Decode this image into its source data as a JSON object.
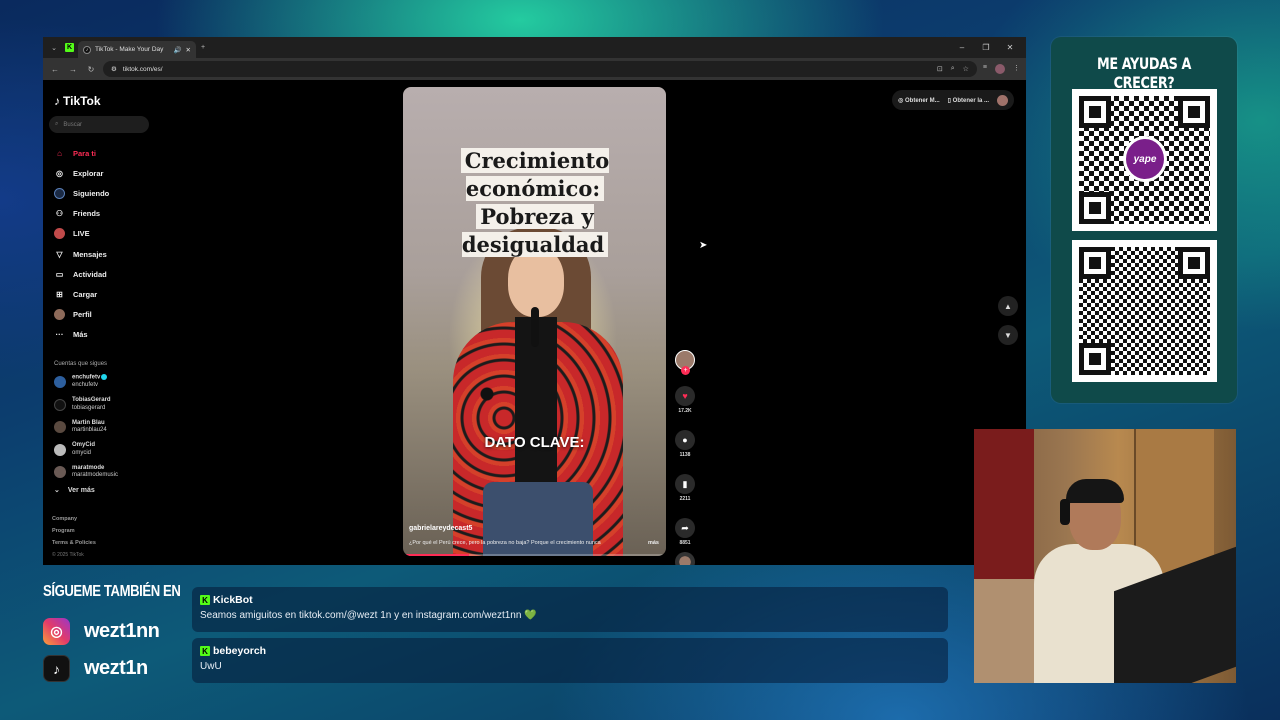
{
  "colors": {
    "accent_tiktok": "#fe2c55",
    "kick_green": "#53fc18",
    "panel_teal": "#0f4a4a"
  },
  "browser": {
    "tab_title": "TikTok - Make Your Day",
    "url": "tiktok.com/es/",
    "window_controls": [
      "–",
      "❐",
      "✕"
    ]
  },
  "tiktok": {
    "logo": "TikTok",
    "search_placeholder": "Buscar",
    "menu": [
      {
        "label": "Para ti",
        "icon": "home-icon"
      },
      {
        "label": "Explorar",
        "icon": "compass-icon"
      },
      {
        "label": "Siguiendo",
        "icon": "following-icon"
      },
      {
        "label": "Friends",
        "icon": "friends-icon"
      },
      {
        "label": "LIVE",
        "icon": "live-icon"
      },
      {
        "label": "Mensajes",
        "icon": "messages-icon"
      },
      {
        "label": "Actividad",
        "icon": "activity-icon"
      },
      {
        "label": "Cargar",
        "icon": "upload-icon"
      },
      {
        "label": "Perfil",
        "icon": "profile-icon"
      },
      {
        "label": "Más",
        "icon": "more-icon"
      }
    ],
    "following_title": "Cuentas que sigues",
    "following": [
      {
        "name": "enchufetv",
        "handle": "enchufetv"
      },
      {
        "name": "TobiasGerard",
        "handle": "tobiasgerard"
      },
      {
        "name": "Martin Blau",
        "handle": "martinblau24"
      },
      {
        "name": "OmyCid",
        "handle": "omycid"
      },
      {
        "name": "maratmode",
        "handle": "maratmodemusic"
      }
    ],
    "see_more": "Ver más",
    "footer": [
      "Company",
      "Program",
      "Terms & Policies"
    ],
    "copyright": "© 2025 TikTok",
    "get_buttons": [
      "Obtener M...",
      "Obtener la ..."
    ],
    "video": {
      "title_line1": "Crecimiento económico:",
      "title_line2": "Pobreza y desigualdad",
      "overlay": "DATO CLAVE:",
      "author": "gabrielareydecast5",
      "caption": "¿Por qué el Perú crece, pero la pobreza no baja? Porque el crecimiento nunca",
      "more": "más",
      "likes": "17.2K",
      "comments": "1138",
      "saves": "2211",
      "shares": "8851"
    }
  },
  "qr_panel": {
    "title": "ME AYUDAS A CRECER?",
    "yape_label": "yape"
  },
  "socials": {
    "title": "SÍGUEME TAMBIÉN EN",
    "instagram": "wezt1nn",
    "tiktok": "wezt1n"
  },
  "chat": [
    {
      "user": "KickBot",
      "text": "Seamos amiguitos en tiktok.com/@wezt 1n y en instagram.com/wezt1nn",
      "emoji": "💚"
    },
    {
      "user": "bebeyorch",
      "text": "UwU",
      "emoji": ""
    }
  ]
}
